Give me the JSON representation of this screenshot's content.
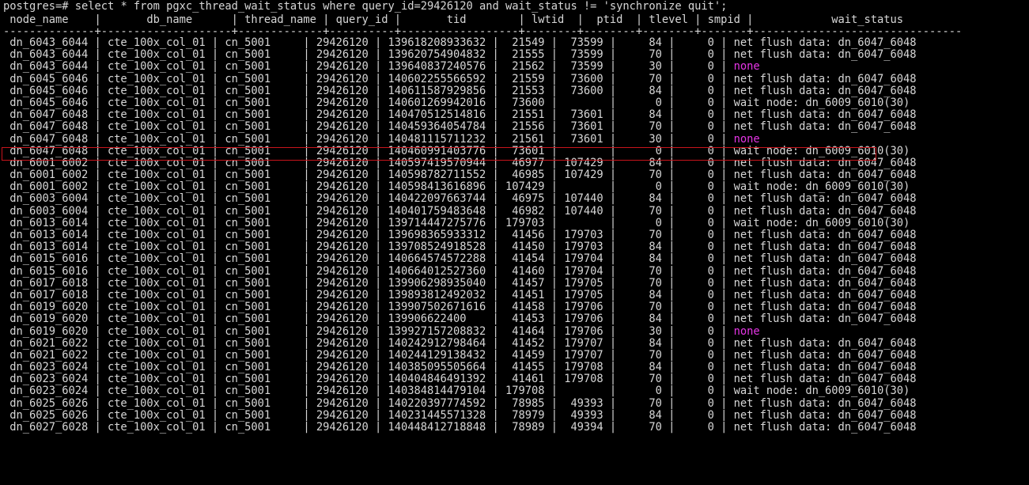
{
  "terminal": {
    "prompt": "postgres=#",
    "command": " select * from pgxc_thread_wait_status where query_id=29426120 and wait_status != 'synchronize quit';",
    "header_line": " node_name    |       db_name      | thread_name | query_id |       tid        | lwtid  |  ptid  | tlevel | smpid |            wait_status",
    "separator_line": "--------------+--------------------+-------------+----------+------------------+--------+--------+--------+-------+--------------------------------",
    "colors": {
      "background": "#000000",
      "text": "#d6d6d6",
      "none_value": "#e535e5",
      "highlight_border": "#c8141c"
    },
    "rows": [
      {
        "prefix": " dn_6043_6044 | cte_100x_col_01 | cn_5001     | 29426120 | 139618208933632 |  21549 |  73599 |     84 |     0 | ",
        "wait_status": "net flush data: dn_6047_6048",
        "none": false
      },
      {
        "prefix": " dn_6043_6044 | cte_100x_col_01 | cn_5001     | 29426120 | 139620754904832 |  21555 |  73599 |     70 |     0 | ",
        "wait_status": "net flush data: dn_6047_6048",
        "none": false
      },
      {
        "prefix": " dn_6043_6044 | cte_100x_col_01 | cn_5001     | 29426120 | 139640837240576 |  21562 |  73599 |     30 |     0 | ",
        "wait_status": "none",
        "none": true
      },
      {
        "prefix": " dn_6045_6046 | cte_100x_col_01 | cn_5001     | 29426120 | 140602255566592 |  21559 |  73600 |     70 |     0 | ",
        "wait_status": "net flush data: dn_6047_6048",
        "none": false
      },
      {
        "prefix": " dn_6045_6046 | cte_100x_col_01 | cn_5001     | 29426120 | 140611587929856 |  21553 |  73600 |     84 |     0 | ",
        "wait_status": "net flush data: dn_6047_6048",
        "none": false
      },
      {
        "prefix": " dn_6045_6046 | cte_100x_col_01 | cn_5001     | 29426120 | 140601269942016 |  73600 |        |      0 |     0 | ",
        "wait_status": "wait node: dn_6009_6010(30)",
        "none": false
      },
      {
        "prefix": " dn_6047_6048 | cte_100x_col_01 | cn_5001     | 29426120 | 140470512514816 |  21551 |  73601 |     84 |     0 | ",
        "wait_status": "net flush data: dn_6047_6048",
        "none": false
      },
      {
        "prefix": " dn_6047_6048 | cte_100x_col_01 | cn_5001     | 29426120 | 140459364054784 |  21556 |  73601 |     70 |     0 | ",
        "wait_status": "net flush data: dn_6047_6048",
        "none": false
      },
      {
        "prefix": " dn_6047_6048 | cte_100x_col_01 | cn_5001     | 29426120 | 140481115711232 |  21561 |  73601 |     30 |     0 | ",
        "wait_status": "none",
        "none": true
      },
      {
        "prefix": " dn_6047_6048 | cte_100x_col_01 | cn_5001     | 29426120 | 140460991403776 |  73601 |        |      0 |     0 | ",
        "wait_status": "wait node: dn_6009_6010(30)",
        "none": false
      },
      {
        "prefix": " dn_6001_6002 | cte_100x_col_01 | cn_5001     | 29426120 | 140597419570944 |  46977 | 107429 |     84 |     0 | ",
        "wait_status": "net flush data: dn_6047_6048",
        "none": false
      },
      {
        "prefix": " dn_6001_6002 | cte_100x_col_01 | cn_5001     | 29426120 | 140598782711552 |  46985 | 107429 |     70 |     0 | ",
        "wait_status": "net flush data: dn_6047_6048",
        "none": false
      },
      {
        "prefix": " dn_6001_6002 | cte_100x_col_01 | cn_5001     | 29426120 | 140598413616896 | 107429 |        |      0 |     0 | ",
        "wait_status": "wait node: dn_6009_6010(30)",
        "none": false
      },
      {
        "prefix": " dn_6003_6004 | cte_100x_col_01 | cn_5001     | 29426120 | 140422097663744 |  46975 | 107440 |     84 |     0 | ",
        "wait_status": "net flush data: dn_6047_6048",
        "none": false
      },
      {
        "prefix": " dn_6003_6004 | cte_100x_col_01 | cn_5001     | 29426120 | 140401759483648 |  46982 | 107440 |     70 |     0 | ",
        "wait_status": "net flush data: dn_6047_6048",
        "none": false
      },
      {
        "prefix": " dn_6013_6014 | cte_100x_col_01 | cn_5001     | 29426120 | 139714447275776 | 179703 |        |      0 |     0 | ",
        "wait_status": "wait node: dn_6009_6010(30)",
        "none": false
      },
      {
        "prefix": " dn_6013_6014 | cte_100x_col_01 | cn_5001     | 29426120 | 139698365933312 |  41456 | 179703 |     70 |     0 | ",
        "wait_status": "net flush data: dn_6047_6048",
        "none": false
      },
      {
        "prefix": " dn_6013_6014 | cte_100x_col_01 | cn_5001     | 29426120 | 139708524918528 |  41450 | 179703 |     84 |     0 | ",
        "wait_status": "net flush data: dn_6047_6048",
        "none": false
      },
      {
        "prefix": " dn_6015_6016 | cte_100x_col_01 | cn_5001     | 29426120 | 140664574572288 |  41454 | 179704 |     84 |     0 | ",
        "wait_status": "net flush data: dn_6047_6048",
        "none": false
      },
      {
        "prefix": " dn_6015_6016 | cte_100x_col_01 | cn_5001     | 29426120 | 140664012527360 |  41460 | 179704 |     70 |     0 | ",
        "wait_status": "net flush data: dn_6047_6048",
        "none": false
      },
      {
        "prefix": " dn_6017_6018 | cte_100x_col_01 | cn_5001     | 29426120 | 139906298935040 |  41457 | 179705 |     70 |     0 | ",
        "wait_status": "net flush data: dn_6047_6048",
        "none": false
      },
      {
        "prefix": " dn_6017_6018 | cte_100x_col_01 | cn_5001     | 29426120 | 139893812492032 |  41451 | 179705 |     84 |     0 | ",
        "wait_status": "net flush data: dn_6047_6048",
        "none": false
      },
      {
        "prefix": " dn_6019_6020 | cte_100x_col_01 | cn_5001     | 29426120 | 139907502671616 |  41458 | 179706 |     70 |     0 | ",
        "wait_status": "net flush data: dn_6047_6048",
        "none": false
      },
      {
        "prefix": " dn_6019_6020 | cte_100x_col_01 | cn_5001     | 29426120 | 139906622400    |  41453 | 179706 |     84 |     0 | ",
        "wait_status": "net flush data: dn_6047_6048",
        "none": false
      },
      {
        "prefix": " dn_6019_6020 | cte_100x_col_01 | cn_5001     | 29426120 | 139927157208832 |  41464 | 179706 |     30 |     0 | ",
        "wait_status": "none",
        "none": true
      },
      {
        "prefix": " dn_6021_6022 | cte_100x_col_01 | cn_5001     | 29426120 | 140242912798464 |  41452 | 179707 |     84 |     0 | ",
        "wait_status": "net flush data: dn_6047_6048",
        "none": false
      },
      {
        "prefix": " dn_6021_6022 | cte_100x_col_01 | cn_5001     | 29426120 | 140244129138432 |  41459 | 179707 |     70 |     0 | ",
        "wait_status": "net flush data: dn_6047_6048",
        "none": false
      },
      {
        "prefix": " dn_6023_6024 | cte_100x_col_01 | cn_5001     | 29426120 | 140385095505664 |  41455 | 179708 |     84 |     0 | ",
        "wait_status": "net flush data: dn_6047_6048",
        "none": false
      },
      {
        "prefix": " dn_6023_6024 | cte_100x_col_01 | cn_5001     | 29426120 | 140404846491392 |  41461 | 179708 |     70 |     0 | ",
        "wait_status": "net flush data: dn_6047_6048",
        "none": false
      },
      {
        "prefix": " dn_6023_6024 | cte_100x_col_01 | cn_5001     | 29426120 | 140384814479104 | 179708 |        |      0 |     0 | ",
        "wait_status": "wait node: dn_6009_6010(30)",
        "none": false
      },
      {
        "prefix": " dn_6025_6026 | cte_100x_col_01 | cn_5001     | 29426120 | 140220397774592 |  78985 |  49393 |     70 |     0 | ",
        "wait_status": "net flush data: dn_6047_6048",
        "none": false
      },
      {
        "prefix": " dn_6025_6026 | cte_100x_col_01 | cn_5001     | 29426120 | 140231445571328 |  78979 |  49393 |     84 |     0 | ",
        "wait_status": "net flush data: dn_6047_6048",
        "none": false
      },
      {
        "prefix": " dn_6027_6028 | cte_100x_col_01 | cn_5001     | 29426120 | 140448412718848 |  78989 |  49394 |     70 |     0 | ",
        "wait_status": "net flush data: dn_6047_6048",
        "none": false
      }
    ]
  }
}
